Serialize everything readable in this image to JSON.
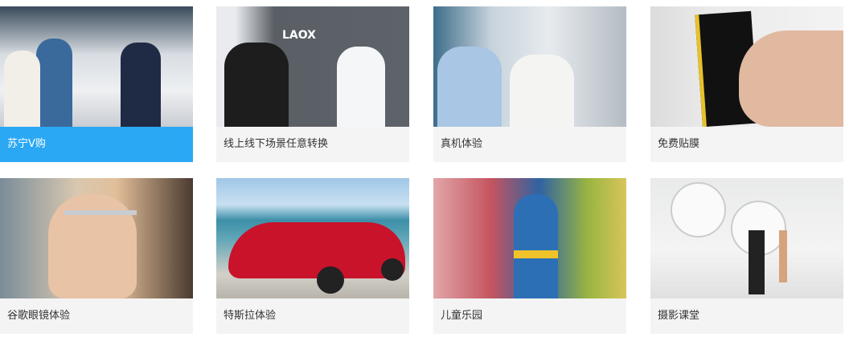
{
  "cards": [
    {
      "label": "苏宁V购",
      "active": true
    },
    {
      "label": "线上线下场景任意转换"
    },
    {
      "label": "真机体验"
    },
    {
      "label": "免费贴膜"
    },
    {
      "label": "谷歌眼镜体验"
    },
    {
      "label": "特斯拉体验"
    },
    {
      "label": "儿童乐园"
    },
    {
      "label": "摄影课堂"
    }
  ],
  "colors": {
    "active_caption": "#2aa8f4",
    "caption_bg": "#f4f4f4",
    "caption_text": "#333333"
  }
}
